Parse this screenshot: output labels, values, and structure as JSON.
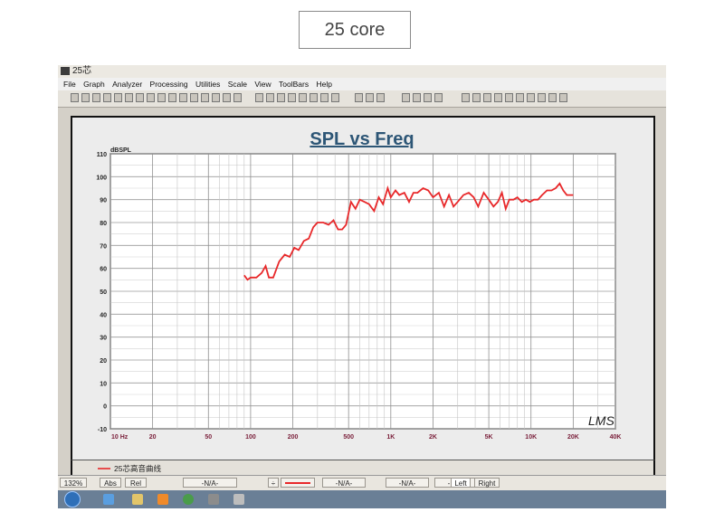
{
  "caption": "25 core",
  "window": {
    "title": "25芯",
    "menu": [
      "File",
      "Graph",
      "Analyzer",
      "Processing",
      "Utilities",
      "Scale",
      "View",
      "ToolBars",
      "Help"
    ]
  },
  "chart_data": {
    "type": "line",
    "title": "SPL vs Freq",
    "ylabel": "dBSPL",
    "xlabel": "",
    "x_scale": "log",
    "xlim": [
      10,
      40000
    ],
    "ylim": [
      -10,
      110
    ],
    "y_ticks": [
      "110",
      "100",
      "90",
      "80",
      "70",
      "60",
      "50",
      "40",
      "30",
      "20",
      "10",
      "0",
      "-10"
    ],
    "x_ticks": [
      {
        "value": 10,
        "label": "10 Hz"
      },
      {
        "value": 20,
        "label": "20"
      },
      {
        "value": 50,
        "label": "50"
      },
      {
        "value": 100,
        "label": "100"
      },
      {
        "value": 200,
        "label": "200"
      },
      {
        "value": 500,
        "label": "500"
      },
      {
        "value": 1000,
        "label": "1K"
      },
      {
        "value": 2000,
        "label": "2K"
      },
      {
        "value": 5000,
        "label": "5K"
      },
      {
        "value": 10000,
        "label": "10K"
      },
      {
        "value": 20000,
        "label": "20K"
      },
      {
        "value": 40000,
        "label": "40K"
      }
    ],
    "grid": true,
    "watermark": "LMS",
    "series": [
      {
        "name": "25芯高音曲线",
        "color": "#e8282a",
        "x": [
          90,
          95,
          100,
          110,
          120,
          128,
          135,
          145,
          160,
          175,
          190,
          205,
          220,
          240,
          260,
          280,
          300,
          330,
          360,
          390,
          420,
          450,
          480,
          520,
          560,
          600,
          650,
          700,
          760,
          820,
          880,
          950,
          1000,
          1080,
          1150,
          1250,
          1350,
          1450,
          1550,
          1700,
          1850,
          2000,
          2200,
          2400,
          2600,
          2800,
          3000,
          3300,
          3600,
          3900,
          4200,
          4600,
          5000,
          5400,
          5800,
          6200,
          6600,
          7000,
          7500,
          8000,
          8600,
          9200,
          9800,
          10500,
          11200,
          12000,
          13000,
          14000,
          15000,
          16000,
          17000,
          18000,
          19000,
          20000
        ],
        "y": [
          57,
          55,
          56,
          56,
          58,
          61,
          56,
          56,
          63,
          66,
          65,
          69,
          68,
          72,
          73,
          78,
          80,
          80,
          79,
          81,
          77,
          77,
          79,
          89,
          86,
          90,
          89,
          88,
          85,
          91,
          88,
          95,
          91,
          94,
          92,
          93,
          89,
          93,
          93,
          95,
          94,
          91,
          93,
          87,
          92,
          87,
          89,
          92,
          93,
          91,
          87,
          93,
          90,
          87,
          89,
          93,
          86,
          90,
          90,
          91,
          89,
          90,
          89,
          90,
          90,
          92,
          94,
          94,
          95,
          97,
          94,
          92,
          92,
          92
        ]
      }
    ]
  },
  "legend": {
    "label": "25芯高音曲线"
  },
  "status": {
    "zoom": "132%",
    "abs": "Abs",
    "rel": "Rel",
    "na1": "-N/A-",
    "na2": "-N/A-",
    "na3": "-N/A-",
    "na4": "-N/A-",
    "left": "Left",
    "right": "Right"
  }
}
